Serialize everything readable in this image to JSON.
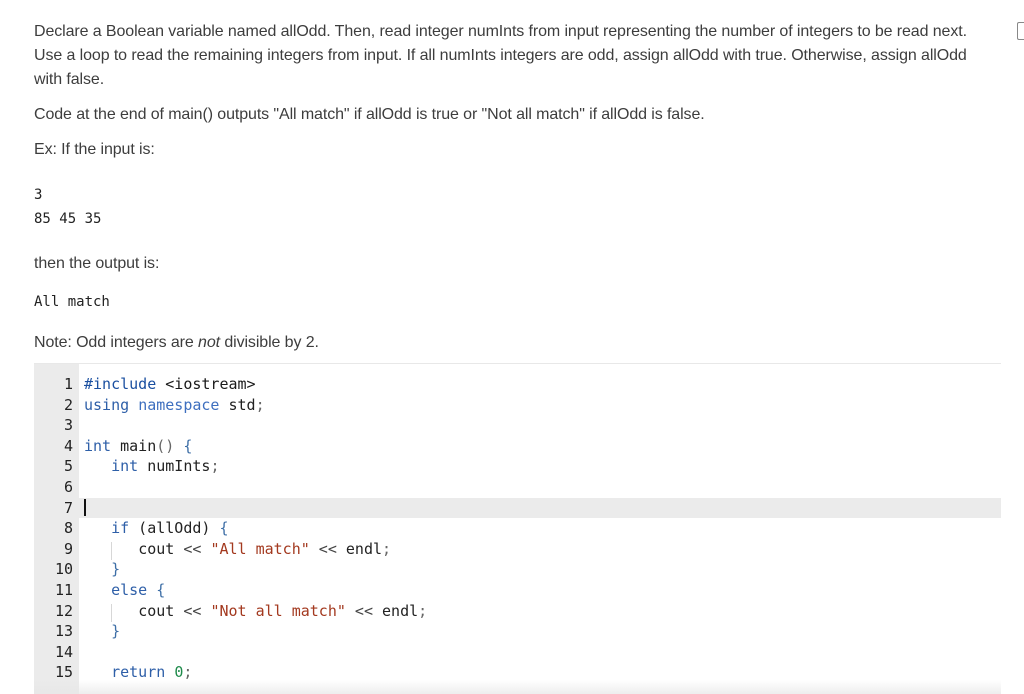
{
  "prompt": {
    "p1": "Declare a Boolean variable named allOdd. Then, read integer numInts from input representing the number of integers to be read next. Use a loop to read the remaining integers from input. If all numInts integers are odd, assign allOdd with true. Otherwise, assign allOdd with false.",
    "p2": "Code at the end of main() outputs \"All match\" if allOdd is true or \"Not all match\" if allOdd is false.",
    "p3": "Ex: If the input is:",
    "input_lines": [
      "3",
      "85 45 35"
    ],
    "p4": "then the output is:",
    "output_line": "All match",
    "note_prefix": "Note: Odd integers are ",
    "note_em": "not",
    "note_suffix": " divisible by 2."
  },
  "editor": {
    "line_numbers": [
      "1",
      "2",
      "3",
      "4",
      "5",
      "6",
      "7",
      "8",
      "9",
      "10",
      "11",
      "12",
      "13",
      "14",
      "15"
    ],
    "active_line": 7,
    "code": {
      "l1_directive": "#include",
      "l1_header": " <iostream>",
      "l2_using": "using",
      "l2_namespace": "namespace",
      "l2_std": "std",
      "l2_semi": ";",
      "l4_type": "int",
      "l4_name": " main",
      "l4_parens": "()",
      "l4_brace": " {",
      "l5_type": "int",
      "l5_var": " numInts",
      "l5_semi": ";",
      "l8_if": "if",
      "l8_cond": " (allOdd)",
      "l8_brace": " {",
      "l9_cout": "cout",
      "l9_op1": " << ",
      "l9_str": "\"All match\"",
      "l9_op2": " << ",
      "l9_endl": "endl",
      "l9_semi": ";",
      "l10_brace": "}",
      "l11_else": "else",
      "l11_brace": " {",
      "l12_cout": "cout",
      "l12_op1": " << ",
      "l12_str": "\"Not all match\"",
      "l12_op2": " << ",
      "l12_endl": "endl",
      "l12_semi": ";",
      "l13_brace": "}",
      "l15_return": "return",
      "l15_num": "0",
      "l15_semi": ";"
    }
  }
}
